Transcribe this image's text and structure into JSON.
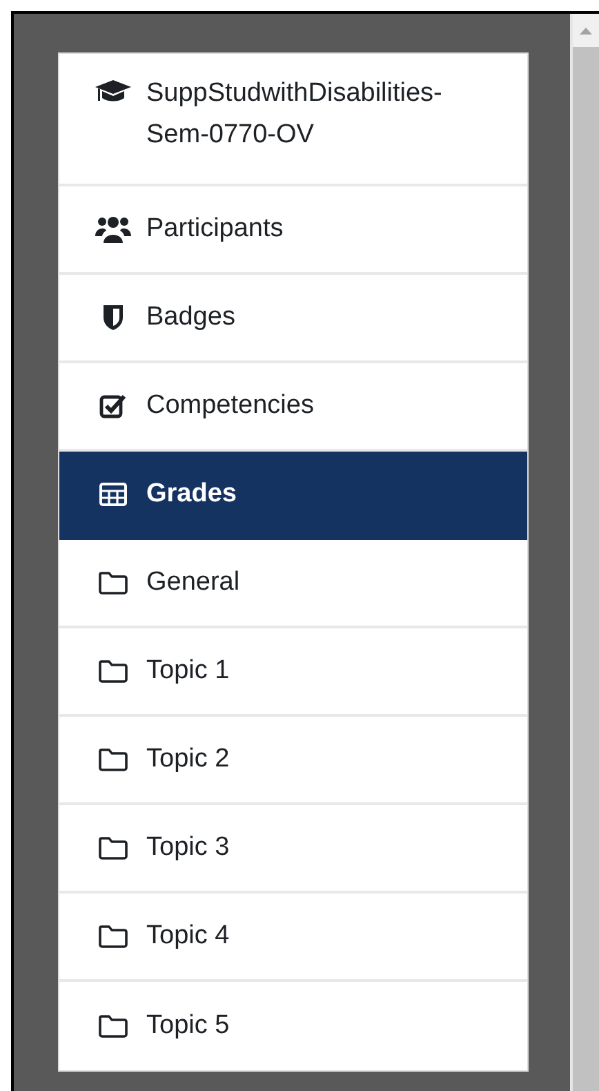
{
  "menu": {
    "items": [
      {
        "kind": "course",
        "label": "SuppStudwithDisabilities-Sem-0770-OV",
        "selected": false
      },
      {
        "kind": "participants",
        "label": "Participants",
        "selected": false
      },
      {
        "kind": "badges",
        "label": "Badges",
        "selected": false
      },
      {
        "kind": "competencies",
        "label": "Competencies",
        "selected": false
      },
      {
        "kind": "grades",
        "label": "Grades",
        "selected": true
      },
      {
        "kind": "section",
        "label": "General",
        "selected": false
      },
      {
        "kind": "section",
        "label": "Topic 1",
        "selected": false
      },
      {
        "kind": "section",
        "label": "Topic 2",
        "selected": false
      },
      {
        "kind": "section",
        "label": "Topic 3",
        "selected": false
      },
      {
        "kind": "section",
        "label": "Topic 4",
        "selected": false
      },
      {
        "kind": "section",
        "label": "Topic 5",
        "selected": false
      }
    ]
  }
}
